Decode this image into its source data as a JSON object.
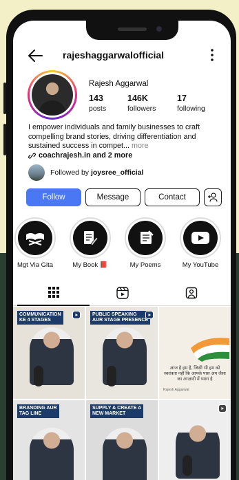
{
  "profile": {
    "username": "rajeshaggarwalofficial",
    "display_name": "Rajesh Aggarwal",
    "posts_count": "143",
    "posts_label": "posts",
    "followers_count": "146K",
    "followers_label": "followers",
    "following_count": "17",
    "following_label": "following",
    "bio_line1": "I empower individuals and family businesses to craft",
    "bio_line2": "compelling brand stories, driving differentiation and",
    "bio_line3": "sustained success in compet...",
    "bio_more": "more",
    "link_text": "coachrajesh.in and 2 more",
    "followed_by_prefix": "Followed by",
    "followed_by_user": "joysree_official"
  },
  "actions": {
    "follow_label": "Follow",
    "message_label": "Message",
    "contact_label": "Contact"
  },
  "highlights": [
    {
      "label": "Mgt Via Gita",
      "icon": "book-stand-icon"
    },
    {
      "label": "My Book 📕",
      "icon": "writing-hand-icon"
    },
    {
      "label": "My Poems",
      "icon": "scroll-icon"
    },
    {
      "label": "My YouTube",
      "icon": "youtube-icon"
    }
  ],
  "tabs": [
    {
      "name": "posts-grid",
      "icon": "grid-icon",
      "active": true
    },
    {
      "name": "reels",
      "icon": "reels-icon",
      "active": false
    },
    {
      "name": "tagged",
      "icon": "tagged-icon",
      "active": false
    }
  ],
  "posts": [
    {
      "caption": "COMMUNICATION\nKE 4 STAGES",
      "bg": "#e7e2d9"
    },
    {
      "caption": "PUBLIC SPEAKING\nAUR STAGE PRESENCE",
      "bg": "#e9e6e0"
    },
    {
      "caption": "",
      "text": "आज है हम है, जिसी भी हम को\nस्वतंत्रता नहीं कि आपके पास अप जैसा\nका आज़ादी में प्यारा है",
      "signature": "Rajesh Aggarwal",
      "bg": "#f4efe6"
    },
    {
      "caption": "BRANDING AUR\nTAG LINE",
      "bg": "#e4e4e4"
    },
    {
      "caption": "SUPPLY & CREATE A\nNEW MARKET",
      "bg": "#dcdcdc"
    },
    {
      "caption": "",
      "bg": "#eeeeee"
    }
  ],
  "colors": {
    "follow_blue": "#4a78f5",
    "background_yellow": "#f3f0c8",
    "background_green": "#2a3f32"
  }
}
